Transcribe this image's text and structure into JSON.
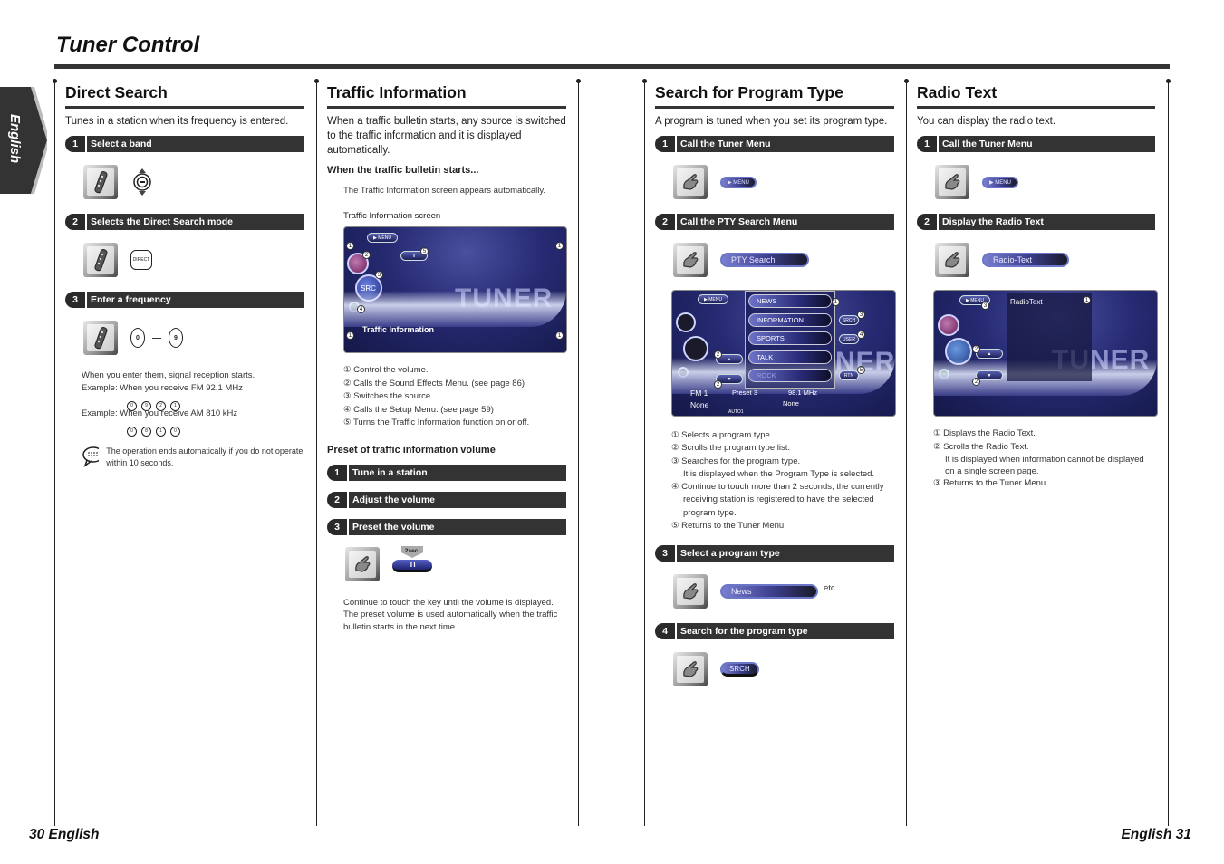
{
  "page": {
    "title": "Tuner Control",
    "language_tab": "English",
    "footer_left": "30 English",
    "footer_right": "English 31"
  },
  "direct_search": {
    "title": "Direct Search",
    "intro": "Tunes in a station when its frequency is entered.",
    "steps": [
      {
        "num": "1",
        "label": "Select a band"
      },
      {
        "num": "2",
        "label": "Selects the Direct Search mode"
      },
      {
        "num": "3",
        "label": "Enter a frequency"
      }
    ],
    "direct_key_label": "DIRECT",
    "key_from": "0",
    "key_to": "9",
    "note": "When you enter them, signal reception starts.",
    "example_fm": "Example: When you receive FM 92.1 MHz",
    "example_fm_keys": [
      "0",
      "9",
      "2",
      "1"
    ],
    "example_am": "Example: When you receive AM 810 kHz",
    "example_am_keys": [
      "0",
      "8",
      "1",
      "0"
    ],
    "tip": "The operation ends automatically if you do not operate within 10 seconds."
  },
  "traffic_info": {
    "title": "Traffic Information",
    "intro": "When a traffic bulletin starts, any source is switched to the traffic information and it is displayed automatically.",
    "sub_heading": "When the traffic bulletin starts...",
    "sub_text": "The Traffic Information screen appears automatically.",
    "screen_caption": "Traffic Information screen",
    "screen": {
      "menu_btn": "▶ MENU",
      "src_btn": "SRC",
      "ti_btn": "II",
      "watermark": "TUNER",
      "label": "Traffic Information"
    },
    "legend": [
      "① Control the volume.",
      "② Calls the Sound Effects Menu. (see page 86)",
      "③ Switches the source.",
      "④ Calls the Setup Menu. (see page 59)",
      "⑤ Turns the Traffic Information function on or off."
    ],
    "preset_heading": "Preset of traffic information volume",
    "preset_steps": [
      {
        "num": "1",
        "label": "Tune in a station"
      },
      {
        "num": "2",
        "label": "Adjust the volume"
      },
      {
        "num": "3",
        "label": "Preset the volume"
      }
    ],
    "hold_label": "2sec.",
    "ti_key": "TI",
    "preset_note1": "Continue to touch the key until the volume is displayed.",
    "preset_note2": "The preset volume is used automatically when the traffic bulletin starts in the next time."
  },
  "pty_search": {
    "title": "Search for Program Type",
    "intro": "A program is tuned when you set its program type.",
    "steps": [
      {
        "num": "1",
        "label": "Call the Tuner Menu"
      },
      {
        "num": "2",
        "label": "Call the PTY Search Menu"
      },
      {
        "num": "3",
        "label": "Select a program type"
      },
      {
        "num": "4",
        "label": "Search for the program type"
      }
    ],
    "menu_key": "▶ MENU",
    "pty_key": "PTY Search",
    "screen": {
      "menu_btn": "▶ MENU",
      "items": [
        "NEWS",
        "INFORMATION",
        "SPORTS",
        "TALK",
        "ROCK"
      ],
      "srch_btn": "SRCH",
      "user_btn": "USER",
      "rtn_btn": "RTN",
      "band": "FM 1",
      "preset": "Preset 3",
      "freq": "98.1 MHz",
      "ps_name": "None",
      "pty_name": "None",
      "mode": "AUTO1",
      "watermark": "NER"
    },
    "legend": [
      "① Selects a program type.",
      "② Scrolls the program type list.",
      "③ Searches for the program type.",
      "It is displayed when the Program Type is selected.",
      "④ Continue to touch more than 2 seconds, the currently receiving station is registered to have the selected program type.",
      "⑤ Returns to the Tuner Menu."
    ],
    "news_key": "News",
    "etc": "etc.",
    "srch_key": "SRCH"
  },
  "radio_text": {
    "title": "Radio Text",
    "intro": "You can display the radio text.",
    "steps": [
      {
        "num": "1",
        "label": "Call the Tuner Menu"
      },
      {
        "num": "2",
        "label": "Display the Radio Text"
      }
    ],
    "menu_key": "▶ MENU",
    "rt_key": "Radio-Text",
    "screen": {
      "menu_btn": "▶ MENU",
      "panel_title": "RadioText",
      "watermark": "TUNER"
    },
    "legend": [
      "① Displays the Radio Text.",
      "② Scrolls the Radio Text.",
      "It is displayed when information cannot be displayed on a single screen page.",
      "③ Returns to the Tuner Menu."
    ]
  }
}
